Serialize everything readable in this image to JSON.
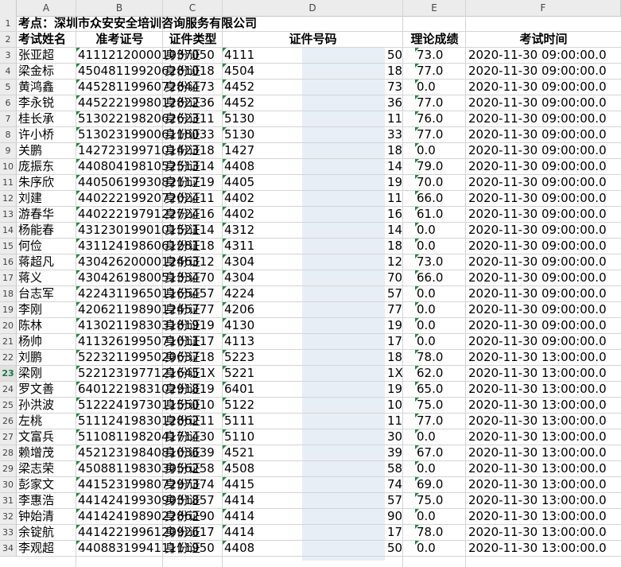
{
  "columns": [
    "A",
    "B",
    "C",
    "D",
    "E",
    "F"
  ],
  "title": "考点：深圳市众安安全培训咨询服务有限公司",
  "headers": [
    "考试姓名",
    "准考证号",
    "证件类型",
    "证件号码",
    "理论成绩",
    "考试时间"
  ],
  "selected_row": "23",
  "rows": [
    [
      "3",
      "张亚超",
      "411121200001037050",
      "身份证",
      "4111",
      "50",
      "73.0",
      "2020-11-30 09:00:00.0"
    ],
    [
      "4",
      "梁金标",
      "450481199206281018",
      "身份证",
      "4504",
      "18",
      "77.0",
      "2020-11-30 09:00:00.0"
    ],
    [
      "5",
      "黄鸿鑫",
      "445281199607284473",
      "身份证",
      "4452",
      "73",
      "0.0",
      "2020-11-30 09:00:00.0"
    ],
    [
      "6",
      "李永锐",
      "445222199801282236",
      "身份证",
      "4452",
      "36",
      "77.0",
      "2020-11-30 09:00:00.0"
    ],
    [
      "7",
      "桂长承",
      "513022198206262311",
      "身份证",
      "5130",
      "11",
      "76.0",
      "2020-11-30 09:00:00.0"
    ],
    [
      "8",
      "许小桥",
      "513023199006118033",
      "身份证",
      "5130",
      "33",
      "77.0",
      "2020-11-30 09:00:00.0"
    ],
    [
      "9",
      "关鹏",
      "142723199710142318",
      "身份证",
      "1427",
      "18",
      "0.0",
      "2020-11-30 09:00:00.0"
    ],
    [
      "10",
      "庞振东",
      "440804198105251314",
      "身份证",
      "4408",
      "14",
      "79.0",
      "2020-11-30 09:00:00.0"
    ],
    [
      "11",
      "朱序欣",
      "440506199308211719",
      "身份证",
      "4405",
      "19",
      "70.0",
      "2020-11-30 09:00:00.0"
    ],
    [
      "12",
      "刘建",
      "440222199207202411",
      "身份证",
      "4402",
      "11",
      "66.0",
      "2020-11-30 09:00:00.0"
    ],
    [
      "13",
      "游春华",
      "440222197912272416",
      "身份证",
      "4402",
      "16",
      "61.0",
      "2020-11-30 09:00:00.0"
    ],
    [
      "14",
      "杨能春",
      "431230199010152114",
      "身份证",
      "4312",
      "14",
      "0.0",
      "2020-11-30 09:00:00.0"
    ],
    [
      "15",
      "何俭",
      "431124198606128118",
      "身份证",
      "4311",
      "18",
      "0.0",
      "2020-11-30 09:00:00.0"
    ],
    [
      "16",
      "蒋超凡",
      "430426200001246312",
      "身份证",
      "4304",
      "12",
      "73.0",
      "2020-11-30 09:00:00.0"
    ],
    [
      "17",
      "蒋义",
      "430426198005133470",
      "身份证",
      "4304",
      "70",
      "66.0",
      "2020-11-30 09:00:00.0"
    ],
    [
      "18",
      "台志军",
      "422431196501165457",
      "身份证",
      "4224",
      "57",
      "0.0",
      "2020-11-30 09:00:00.0"
    ],
    [
      "19",
      "李刚",
      "420621198901245777",
      "身份证",
      "4206",
      "77",
      "0.0",
      "2020-11-30 09:00:00.0"
    ],
    [
      "20",
      "陈林",
      "413021198303181919",
      "身份证",
      "4130",
      "19",
      "0.0",
      "2020-11-30 09:00:00.0"
    ],
    [
      "21",
      "杨帅",
      "411326199507101117",
      "身份证",
      "4113",
      "17",
      "0.0",
      "2020-11-30 09:00:00.0"
    ],
    [
      "22",
      "刘鹏",
      "522321199502063718",
      "身份证",
      "5223",
      "18",
      "78.0",
      "2020-11-30 13:00:00.0"
    ],
    [
      "23",
      "梁刚",
      "52212319771216451X",
      "身份证",
      "5221",
      "1X",
      "62.0",
      "2020-11-30 13:00:00.0"
    ],
    [
      "24",
      "罗文善",
      "640122198310291819",
      "身份证",
      "6401",
      "19",
      "65.0",
      "2020-11-30 13:00:00.0"
    ],
    [
      "25",
      "孙洪波",
      "512224197301155010",
      "身份证",
      "5122",
      "10",
      "75.0",
      "2020-11-30 13:00:00.0"
    ],
    [
      "26",
      "左桃",
      "511124198301286211",
      "身份证",
      "5111",
      "11",
      "77.0",
      "2020-11-30 13:00:00.0"
    ],
    [
      "27",
      "文富兵",
      "511081198204171430",
      "身份证",
      "5110",
      "30",
      "0.0",
      "2020-11-30 13:00:00.0"
    ],
    [
      "28",
      "赖增茂",
      "452123198408103639",
      "身份证",
      "4521",
      "39",
      "67.0",
      "2020-11-30 13:00:00.0"
    ],
    [
      "29",
      "梁志荣",
      "450881198303056258",
      "身份证",
      "4508",
      "58",
      "0.0",
      "2020-11-30 13:00:00.0"
    ],
    [
      "30",
      "彭家文",
      "441523199807297374",
      "身份证",
      "4415",
      "74",
      "69.0",
      "2020-11-30 13:00:00.0"
    ],
    [
      "31",
      "李惠浩",
      "441424199309031857",
      "身份证",
      "4414",
      "57",
      "75.0",
      "2020-11-30 13:00:00.0"
    ],
    [
      "32",
      "钟始清",
      "441424198902286290",
      "身份证",
      "4414",
      "90",
      "0.0",
      "2020-11-30 13:00:00.0"
    ],
    [
      "33",
      "余锭航",
      "441422199612092617",
      "身份证",
      "4414",
      "17",
      "78.0",
      "2020-11-30 13:00:00.0"
    ],
    [
      "34",
      "李观超",
      "440883199411111950",
      "身份证",
      "4408",
      "50",
      "0.0",
      "2020-11-30 13:00:00.0"
    ]
  ]
}
